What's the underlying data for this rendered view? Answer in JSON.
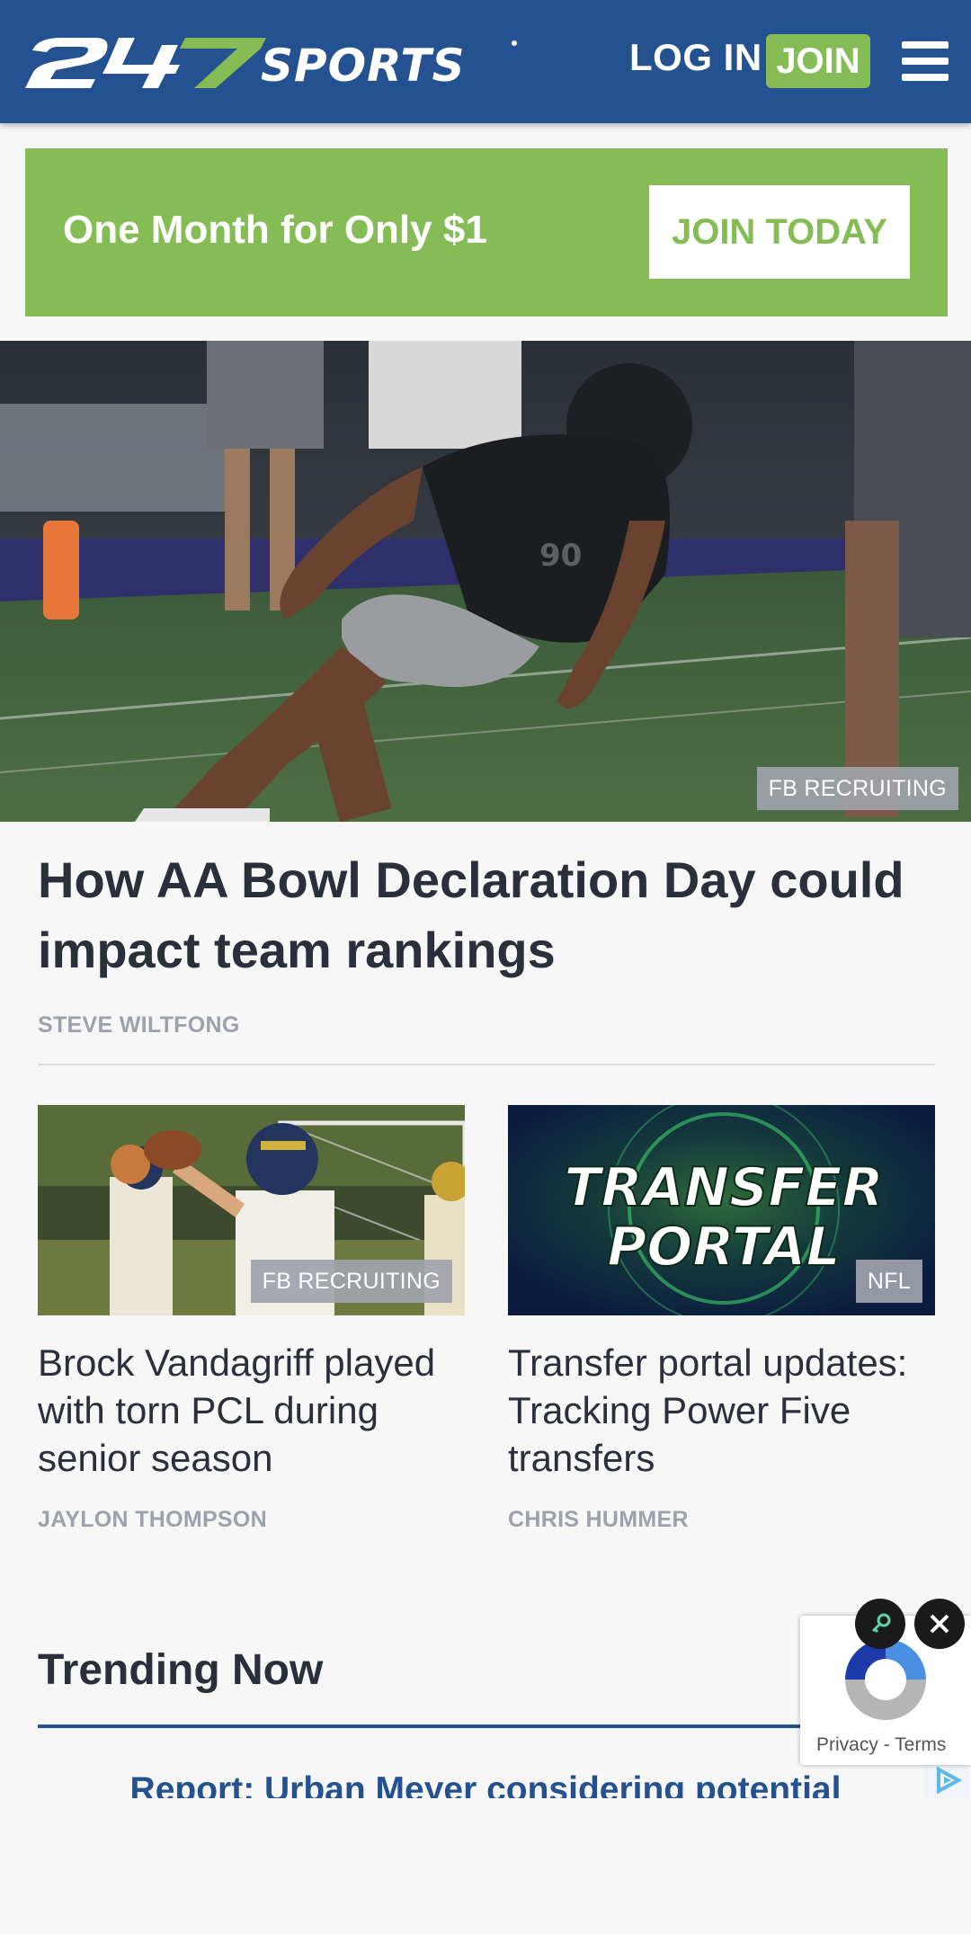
{
  "header": {
    "logo_text": "247SPORTS",
    "login_label": "LOG IN",
    "join_label": "JOIN",
    "menu_icon": "hamburger-menu-icon"
  },
  "promo": {
    "text": "One Month for Only $1",
    "button_label": "JOIN TODAY"
  },
  "hero": {
    "category": "FB RECRUITING",
    "title": "How AA Bowl Declaration Day could impact team rankings",
    "author": "STEVE WILTFONG",
    "image": "football-player-photo"
  },
  "cards": [
    {
      "category": "FB RECRUITING",
      "title": "Brock Vandagriff played with torn PCL during senior season",
      "author": "JAYLON THOMPSON",
      "image": "quarterback-throwing-photo"
    },
    {
      "category": "NFL",
      "title": "Transfer portal updates: Tracking Power Five transfers",
      "author": "CHRIS HUMMER",
      "image_text_line1": "TRANSFER",
      "image_text_line2": "PORTAL"
    }
  ],
  "trending": {
    "title": "Trending Now",
    "first_link": "Report: Urban Meyer considering potential"
  },
  "recaptcha": {
    "privacy_label": "Privacy",
    "separator": "-",
    "terms_label": "Terms"
  },
  "colors": {
    "brand_blue": "#24518f",
    "brand_green": "#86bc56"
  }
}
